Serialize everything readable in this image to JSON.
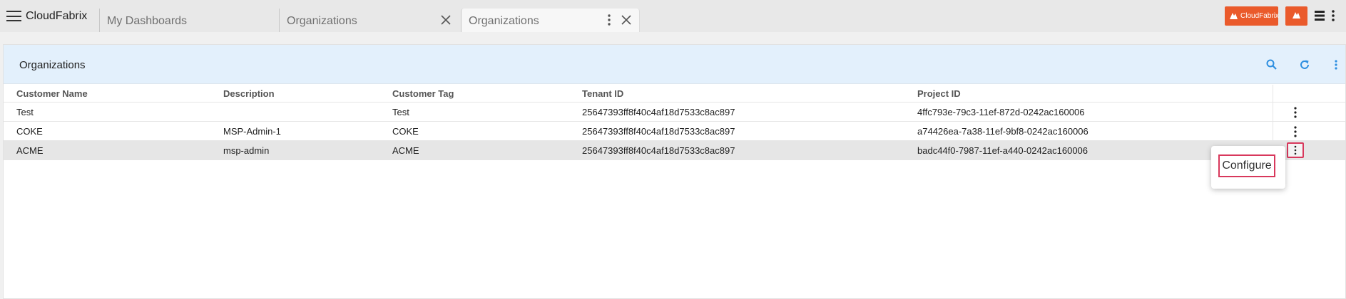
{
  "app": {
    "name": "CloudFabrix"
  },
  "tabs": [
    {
      "label": "My Dashboards"
    },
    {
      "label": "Organizations"
    },
    {
      "label": "Organizations"
    }
  ],
  "colors": {
    "brand": "#ea5a2b",
    "header_bg": "#e3f0fc",
    "accent_icon": "#2e8fe0",
    "focus_outline": "#d8385c"
  },
  "brand_badge": {
    "text": "CloudFabrix"
  },
  "panel": {
    "title": "Organizations"
  },
  "table": {
    "columns": [
      "Customer Name",
      "Description",
      "Customer Tag",
      "Tenant ID",
      "Project ID"
    ],
    "rows": [
      [
        "Test",
        "",
        "Test",
        "25647393ff8f40c4af18d7533c8ac897",
        "4ffc793e-79c3-11ef-872d-0242ac160006"
      ],
      [
        "COKE",
        "MSP-Admin-1",
        "COKE",
        "25647393ff8f40c4af18d7533c8ac897",
        "a74426ea-7a38-11ef-9bf8-0242ac160006"
      ],
      [
        "ACME",
        "msp-admin",
        "ACME",
        "25647393ff8f40c4af18d7533c8ac897",
        "badc44f0-7987-11ef-a440-0242ac160006"
      ]
    ]
  },
  "row_menu": {
    "items": [
      {
        "label": "Configure"
      }
    ]
  }
}
